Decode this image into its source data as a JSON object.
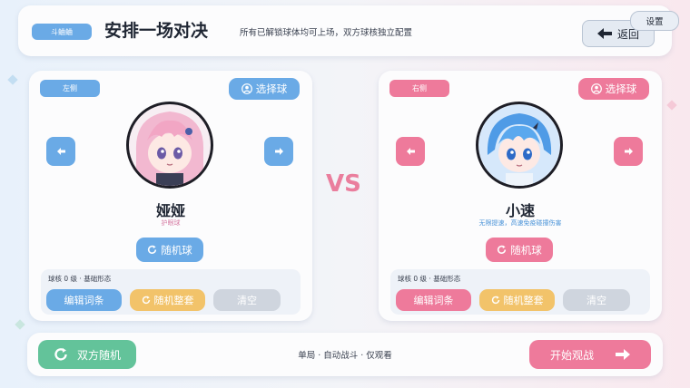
{
  "header": {
    "mode_badge": "斗蛐蛐",
    "title": "安排一场对决",
    "subtitle": "所有已解锁球体均可上场，双方球核独立配置",
    "back_label": "返回",
    "settings_label": "设置"
  },
  "versus_label": "VS",
  "left": {
    "side_label": "左侧",
    "pick_label": "选择球",
    "char_name": "娅娅",
    "char_desc": "护眼球",
    "random_label": "随机球",
    "config_info": "球核 0 级 · 基础形态",
    "edit_label": "编辑词条",
    "random_set_label": "随机整套",
    "clear_label": "清空"
  },
  "right": {
    "side_label": "右侧",
    "pick_label": "选择球",
    "char_name": "小速",
    "char_desc": "无限提速，高速免疫碰撞伤害",
    "random_label": "随机球",
    "config_info": "球核 0 级 · 基础形态",
    "edit_label": "编辑词条",
    "random_set_label": "随机整套",
    "clear_label": "清空"
  },
  "bottom": {
    "both_random_label": "双方随机",
    "mode_note": "单局 · 自动战斗 · 仅观看",
    "start_label": "开始观战"
  },
  "colors": {
    "blue": "#6aaae6",
    "pink": "#ee7a9b",
    "green": "#63c39a",
    "yellow": "#f2c36a",
    "gray": "#cfd5de"
  }
}
